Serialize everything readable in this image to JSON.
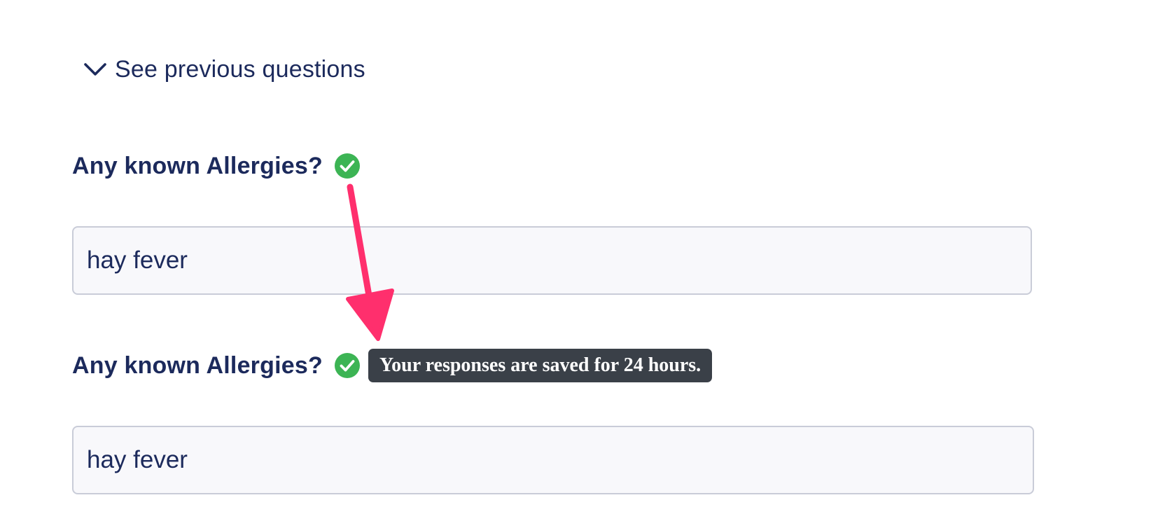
{
  "toggle": {
    "label": "See previous questions",
    "icon": "chevron-down-icon"
  },
  "questions": [
    {
      "label": "Any known Allergies?",
      "status_icon": "check-circle-icon",
      "value": "hay fever"
    },
    {
      "label": "Any known Allergies?",
      "status_icon": "check-circle-icon",
      "value": "hay fever"
    }
  ],
  "tooltip": {
    "text": "Your responses are saved for 24 hours."
  },
  "colors": {
    "text": "#1c2a5c",
    "check": "#3cb454",
    "tooltip_bg": "#3a4048",
    "arrow": "#ff2f6d",
    "field_border": "#c9ccd8",
    "field_bg": "#f8f8fb"
  }
}
